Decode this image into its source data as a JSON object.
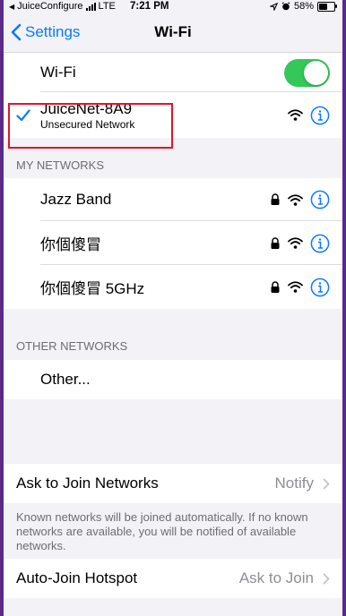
{
  "status_bar": {
    "carrier": "JuiceConfigure",
    "network": "LTE",
    "time": "7:21 PM",
    "battery": "58%",
    "battery_level": 0.58
  },
  "nav": {
    "back_label": "Settings",
    "title": "Wi-Fi"
  },
  "wifi_toggle": {
    "label": "Wi-Fi",
    "on": true
  },
  "connected": {
    "name": "JuiceNet-8A9",
    "subtitle": "Unsecured Network"
  },
  "my_networks": {
    "header": "MY NETWORKS",
    "items": [
      {
        "name": "Jazz Band",
        "secured": true
      },
      {
        "name": "你個傻冒",
        "secured": true
      },
      {
        "name": "你個傻冒 5GHz",
        "secured": true
      }
    ]
  },
  "other_networks": {
    "header": "OTHER NETWORKS",
    "other_label": "Other..."
  },
  "ask_to_join": {
    "label": "Ask to Join Networks",
    "value": "Notify",
    "footer": "Known networks will be joined automatically. If no known networks are available, you will be notified of available networks."
  },
  "auto_join": {
    "label": "Auto-Join Hotspot",
    "value": "Ask to Join"
  },
  "colors": {
    "accent": "#0a7aff",
    "toggle_on": "#34c759",
    "highlight": "#e0152b",
    "frame": "#5a2a8a"
  }
}
